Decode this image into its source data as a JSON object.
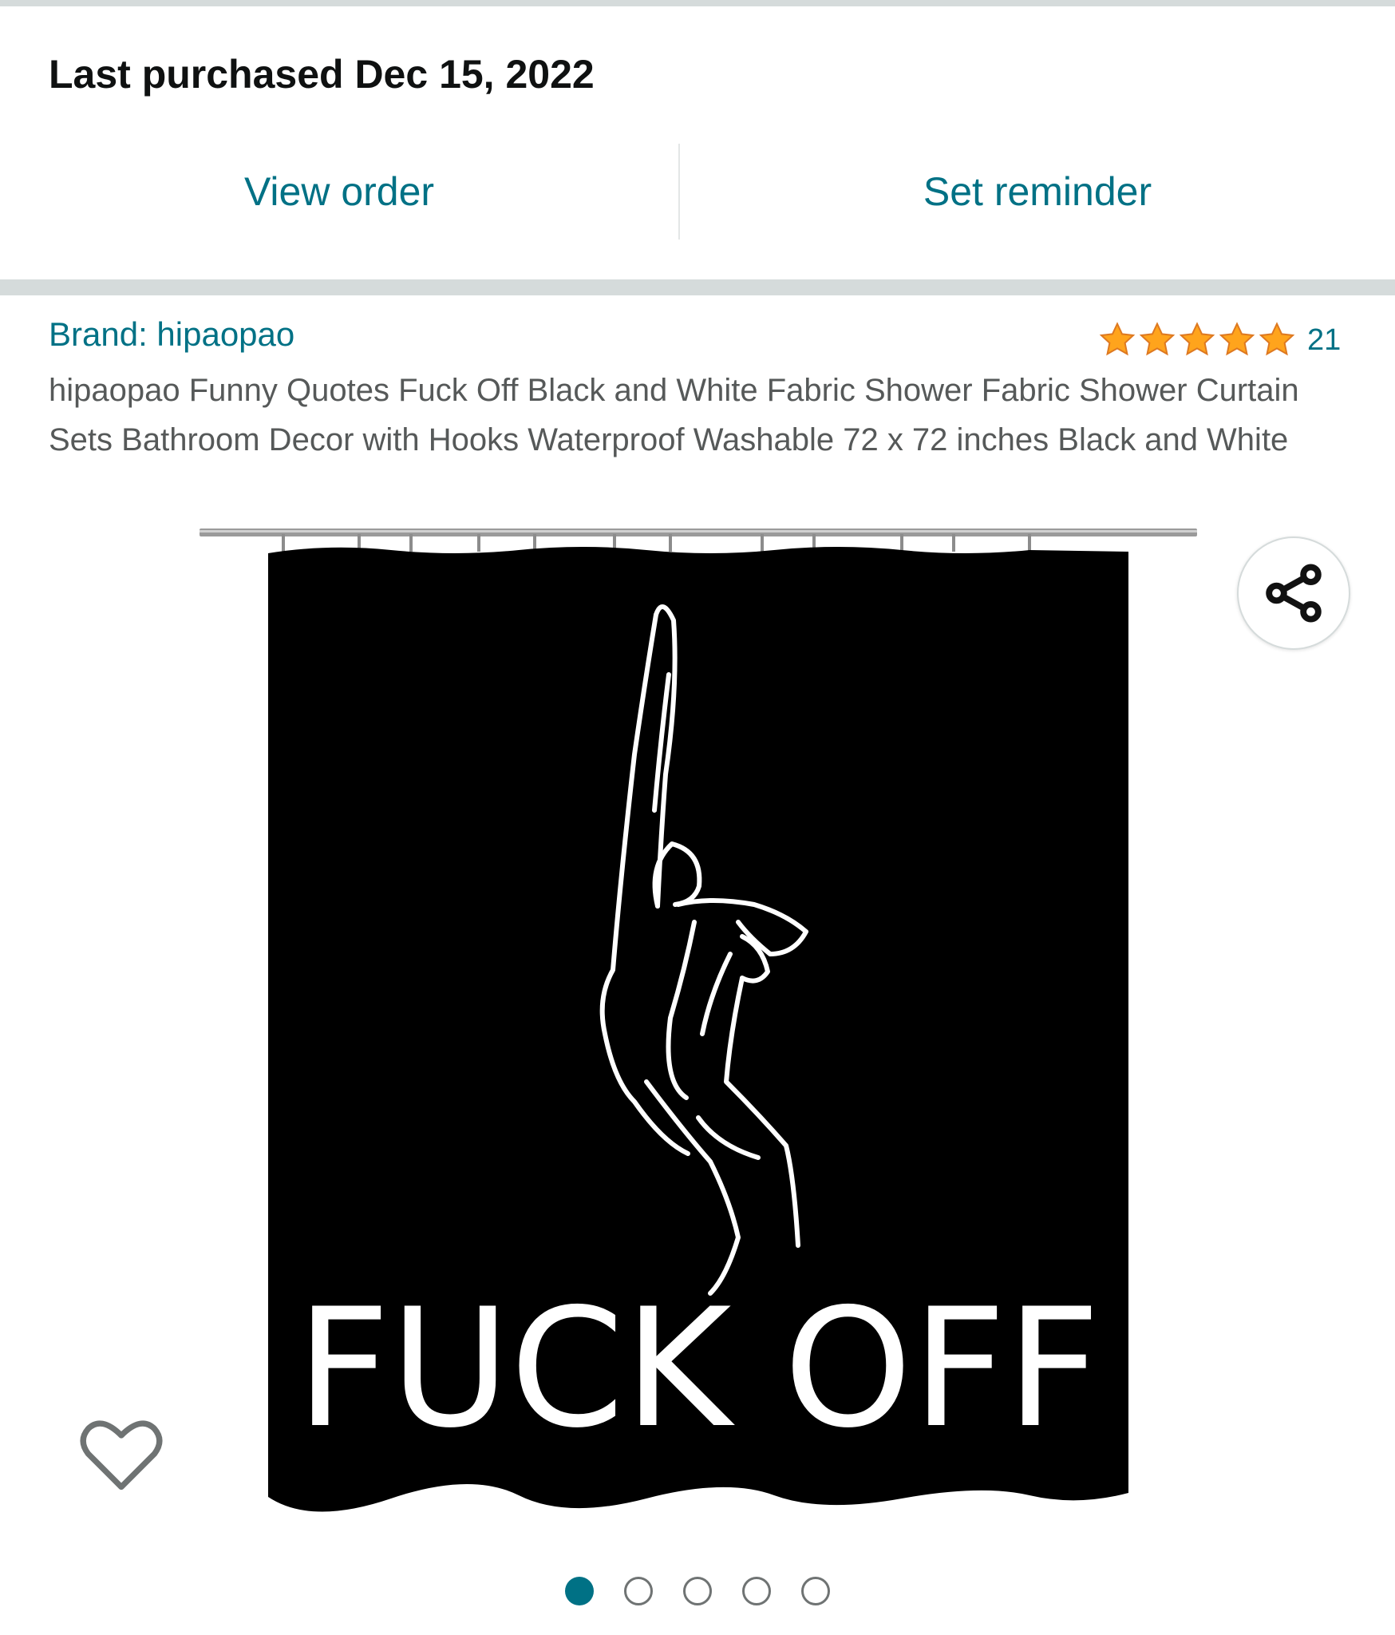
{
  "purchase": {
    "title": "Last purchased Dec 15, 2022"
  },
  "actions": {
    "view_order": "View order",
    "set_reminder": "Set reminder"
  },
  "product": {
    "brand": "Brand: hipaopao",
    "rating": {
      "stars": 5,
      "count": "21"
    },
    "title": "hipaopao Funny Quotes Fuck Off Black and White Fabric Shower Fabric Shower Curtain Sets Bathroom Decor with Hooks Waterproof Washable 72 x 72 inches Black and White",
    "image_text": "FUCK OFF"
  },
  "carousel": {
    "total": 5,
    "active": 1
  },
  "icons": {
    "share": "share-icon",
    "wishlist": "heart-icon",
    "star": "star-icon"
  },
  "colors": {
    "link": "#007185",
    "star": "#ffa41c",
    "star_stroke": "#de7921",
    "separator": "#d5dbdb",
    "curtain": "#000000"
  }
}
